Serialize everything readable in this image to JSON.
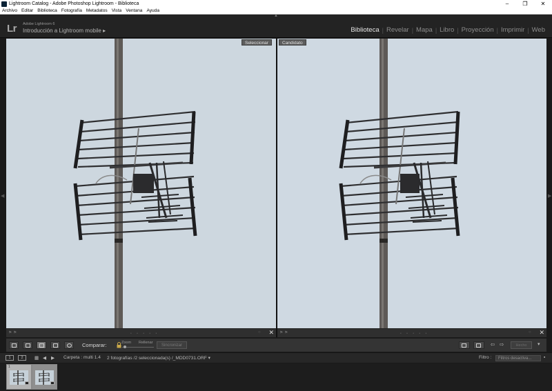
{
  "window": {
    "title": "Lightroom Catalog - Adobe Photoshop Lightroom - Biblioteca",
    "controls": [
      "–",
      "❐",
      "✕"
    ]
  },
  "menu": [
    "Archivo",
    "Editar",
    "Biblioteca",
    "Fotografía",
    "Metadatos",
    "Vista",
    "Ventana",
    "Ayuda"
  ],
  "identity": {
    "logo": "Lr",
    "app_name": "Adobe Lightroom 6",
    "catalog": "Introducción a Lightroom mobile ▸"
  },
  "modules": [
    "Biblioteca",
    "Revelar",
    "Mapa",
    "Libro",
    "Proyección",
    "Imprimir",
    "Web"
  ],
  "active_module": "Biblioteca",
  "compare": {
    "left_label": "Seleccionar",
    "right_label": "Candidato"
  },
  "toolbar": {
    "compare_label": "Comparar:",
    "zoom_label": "Zoom",
    "fill_label": "Rellenar",
    "sync_label": "Sincronizar",
    "finish_label": "Hecho"
  },
  "filmbar": {
    "screen1": "1",
    "screen2": "2",
    "folder": "Carpeta : multi 1.4",
    "count": "2 fotografías /2 seleccionada(s) /_MDD0731.ORF ▾",
    "filter_label": "Filtro :",
    "filter_value": "Filtros desactiva..."
  },
  "thumbnails": [
    {
      "num": "1",
      "state": "selected"
    },
    {
      "num": "",
      "state": "candidate"
    }
  ],
  "colors": {
    "sky": "#cdd7df",
    "panel_dark": "#232323",
    "module_active": "#e6e6e6"
  }
}
